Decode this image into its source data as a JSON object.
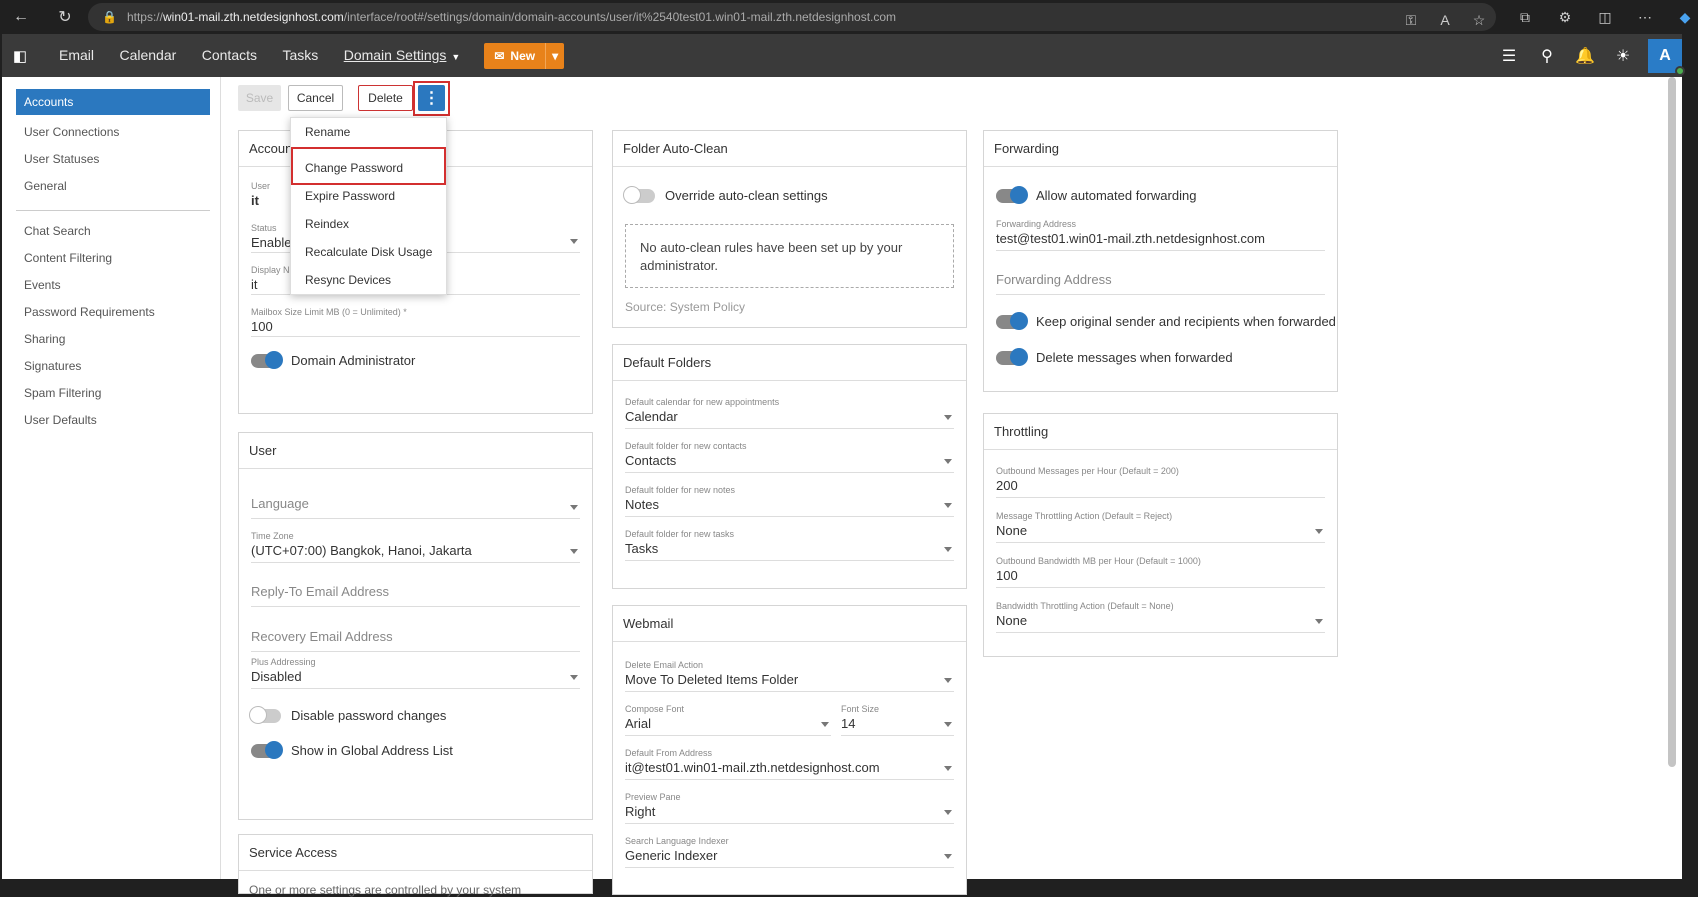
{
  "browser": {
    "url_prefix": "https://",
    "url_host": "win01-mail.zth.netdesignhost.com",
    "url_path": "/interface/root#/settings/domain/domain-accounts/user/it%2540test01.win01-mail.zth.netdesignhost.com"
  },
  "nav": {
    "items": [
      "Email",
      "Calendar",
      "Contacts",
      "Tasks",
      "Domain Settings"
    ],
    "new_label": "New",
    "avatar_letter": "A"
  },
  "sidebar": {
    "items": [
      "Accounts",
      "User Connections",
      "User Statuses",
      "General",
      "Chat Search",
      "Content Filtering",
      "Events",
      "Password Requirements",
      "Sharing",
      "Signatures",
      "Spam Filtering",
      "User Defaults"
    ]
  },
  "toolbar": {
    "save": "Save",
    "cancel": "Cancel",
    "delete": "Delete",
    "more": "⋮"
  },
  "menu": {
    "items": [
      "Rename",
      "Change Password",
      "Expire Password",
      "Reindex",
      "Recalculate Disk Usage",
      "Resync Devices"
    ]
  },
  "account": {
    "title": "Accoun",
    "user_label": "User",
    "user_value": "it",
    "status_label": "Status",
    "status_value": "Enable",
    "display_label": "Display N",
    "display_value": "it",
    "mailbox_label": "Mailbox Size Limit MB (0 = Unlimited) *",
    "mailbox_value": "100",
    "domain_admin": "Domain Administrator"
  },
  "user": {
    "title": "User",
    "language_ph": "Language",
    "tz_label": "Time Zone",
    "tz_value": "(UTC+07:00) Bangkok, Hanoi, Jakarta",
    "reply_ph": "Reply-To Email Address",
    "recovery_ph": "Recovery Email Address",
    "plus_label": "Plus Addressing",
    "plus_value": "Disabled",
    "disable_pw": "Disable password changes",
    "show_gal": "Show in Global Address List"
  },
  "service": {
    "title": "Service Access",
    "note": "One or more settings are controlled by your system"
  },
  "autoclean": {
    "title": "Folder Auto-Clean",
    "override": "Override auto-clean settings",
    "notice": "No auto-clean rules have been set up by your administrator.",
    "source": "Source: System Policy"
  },
  "folders": {
    "title": "Default Folders",
    "cal_label": "Default calendar for new appointments",
    "cal_value": "Calendar",
    "con_label": "Default folder for new contacts",
    "con_value": "Contacts",
    "notes_label": "Default folder for new notes",
    "notes_value": "Notes",
    "tasks_label": "Default folder for new tasks",
    "tasks_value": "Tasks"
  },
  "webmail": {
    "title": "Webmail",
    "del_label": "Delete Email Action",
    "del_value": "Move To Deleted Items Folder",
    "font_label": "Compose Font",
    "font_value": "Arial",
    "size_label": "Font Size",
    "size_value": "14",
    "from_label": "Default From Address",
    "from_value": "it@test01.win01-mail.zth.netdesignhost.com",
    "preview_label": "Preview Pane",
    "preview_value": "Right",
    "search_label": "Search Language Indexer",
    "search_value": "Generic Indexer"
  },
  "forwarding": {
    "title": "Forwarding",
    "allow": "Allow automated forwarding",
    "addr_label": "Forwarding Address",
    "addr_value": "test@test01.win01-mail.zth.netdesignhost.com",
    "addr_ph": "Forwarding Address",
    "keep": "Keep original sender and recipients when forwarded",
    "delete": "Delete messages when forwarded"
  },
  "throttling": {
    "title": "Throttling",
    "out_label": "Outbound Messages per Hour (Default = 200)",
    "out_value": "200",
    "msg_action_label": "Message Throttling Action (Default = Reject)",
    "msg_action_value": "None",
    "bw_label": "Outbound Bandwidth MB per Hour (Default = 1000)",
    "bw_value": "100",
    "bw_action_label": "Bandwidth Throttling Action (Default = None)",
    "bw_action_value": "None"
  }
}
